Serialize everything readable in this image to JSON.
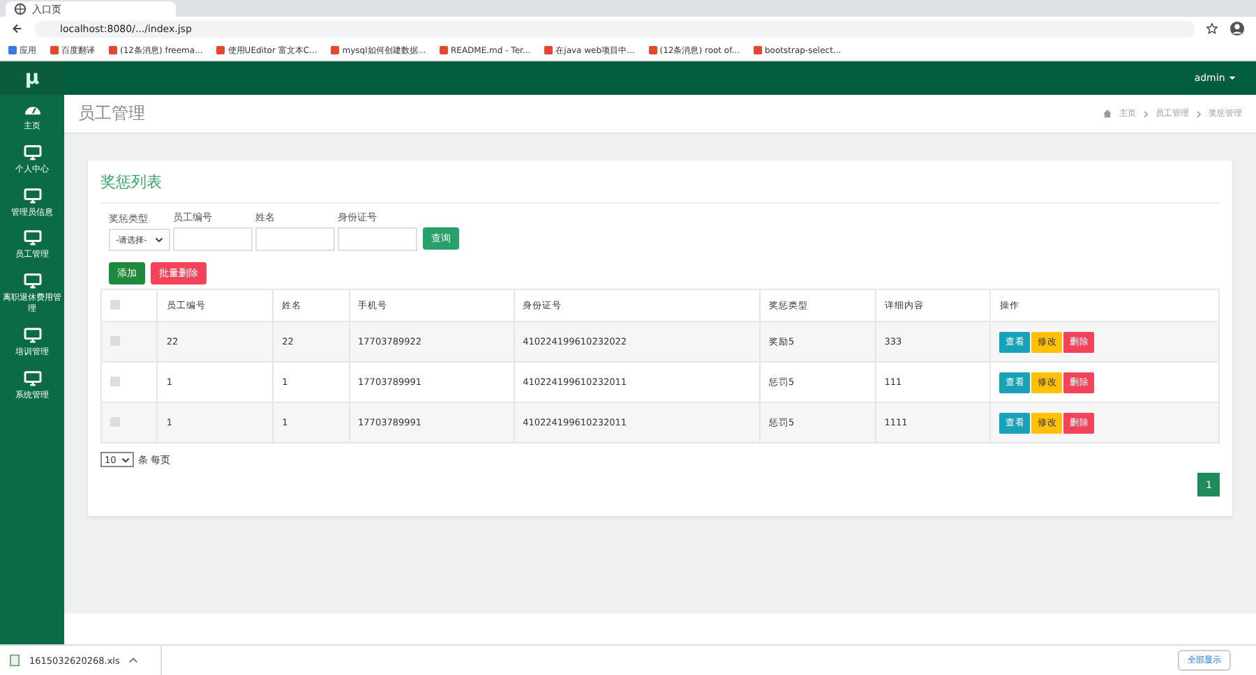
{
  "browser": {
    "tab_title": "入口页",
    "url": "localhost:8080/.../index.jsp",
    "bookmarks": [
      "应用",
      "百度翻译",
      "(12条消息) freema...",
      "使用UEditor 富文本C...",
      "mysql如何创建数据...",
      "README.md - Ter...",
      "在java web项目中...",
      "(12条消息) root of...",
      "bootstrap-select..."
    ]
  },
  "app": {
    "logo": "μ",
    "user": "admin"
  },
  "sidebar": [
    {
      "label": "主页",
      "kind": "gauge"
    },
    {
      "label": "个人中心",
      "kind": "monitor"
    },
    {
      "label": "管理员信息",
      "kind": "monitor"
    },
    {
      "label": "员工管理",
      "kind": "monitor"
    },
    {
      "label": "离职退休费用管理",
      "kind": "monitor"
    },
    {
      "label": "培训管理",
      "kind": "monitor"
    },
    {
      "label": "系统管理",
      "kind": "monitor"
    }
  ],
  "page": {
    "title": "员工管理",
    "breadcrumb": [
      "主页",
      "员工管理",
      "奖惩管理"
    ]
  },
  "card": {
    "title": "奖惩列表",
    "filters": [
      {
        "label": "奖惩类型",
        "kind": "select",
        "value": "-请选择-"
      },
      {
        "label": "员工编号",
        "kind": "input"
      },
      {
        "label": "姓名",
        "kind": "input"
      },
      {
        "label": "身份证号",
        "kind": "input"
      }
    ],
    "search_button": "查询",
    "add_button": "添加",
    "batch_delete_button": "批量删除",
    "table": {
      "columns": [
        "员工编号",
        "姓名",
        "手机号",
        "身份证号",
        "奖惩类型",
        "详细内容",
        "操作"
      ],
      "select_all_checked": false,
      "rows": [
        {
          "checked": false,
          "cells": [
            "22",
            "22",
            "17703789922",
            "410224199610232022",
            "奖励5",
            "333"
          ],
          "actions": [
            "查看",
            "修改",
            "删除"
          ]
        },
        {
          "checked": false,
          "cells": [
            "1",
            "1",
            "17703789991",
            "410224199610232011",
            "惩罚5",
            "111"
          ],
          "actions": [
            "查看",
            "修改",
            "删除"
          ]
        },
        {
          "checked": false,
          "cells": [
            "1",
            "1",
            "17703789991",
            "410224199610232011",
            "惩罚5",
            "1111"
          ],
          "actions": [
            "查看",
            "修改",
            "删除"
          ]
        }
      ]
    },
    "page_size": "10",
    "page_size_label": "条 每页",
    "pages": [
      {
        "label": "1",
        "selected": true
      }
    ]
  },
  "downloads": {
    "file": "1615032620268.xls",
    "show_all": "全部显示"
  }
}
